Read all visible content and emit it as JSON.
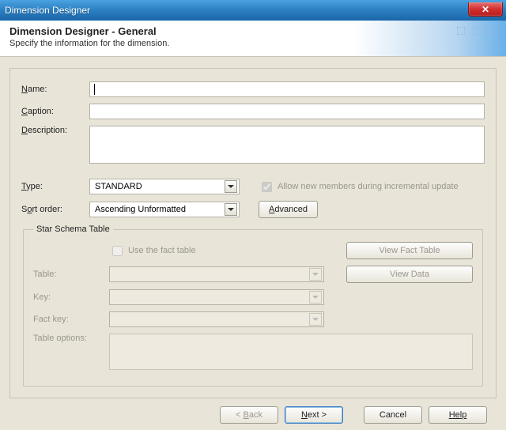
{
  "window": {
    "title": "Dimension Designer"
  },
  "header": {
    "title": "Dimension Designer - General",
    "subtitle": "Specify the information for the dimension."
  },
  "labels": {
    "name": "Name:",
    "caption": "Caption:",
    "description": "Description:",
    "type": "Type:",
    "sort": "Sort order:",
    "allow_new": "Allow new members during incremental update",
    "advanced": "Advanced",
    "star_legend": "Star Schema Table",
    "use_fact": "Use the fact table",
    "view_fact": "View Fact Table",
    "table": "Table:",
    "key": "Key:",
    "fact_key": "Fact key:",
    "table_options": "Table options:",
    "view_data": "View Data"
  },
  "values": {
    "name": "",
    "caption": "",
    "description": "",
    "type": "STANDARD",
    "sort": "Ascending Unformatted",
    "allow_new_checked": true,
    "use_fact_checked": false,
    "table": "",
    "key": "",
    "fact_key": ""
  },
  "footer": {
    "back": "< Back",
    "next": "Next >",
    "cancel": "Cancel",
    "help": "Help"
  }
}
